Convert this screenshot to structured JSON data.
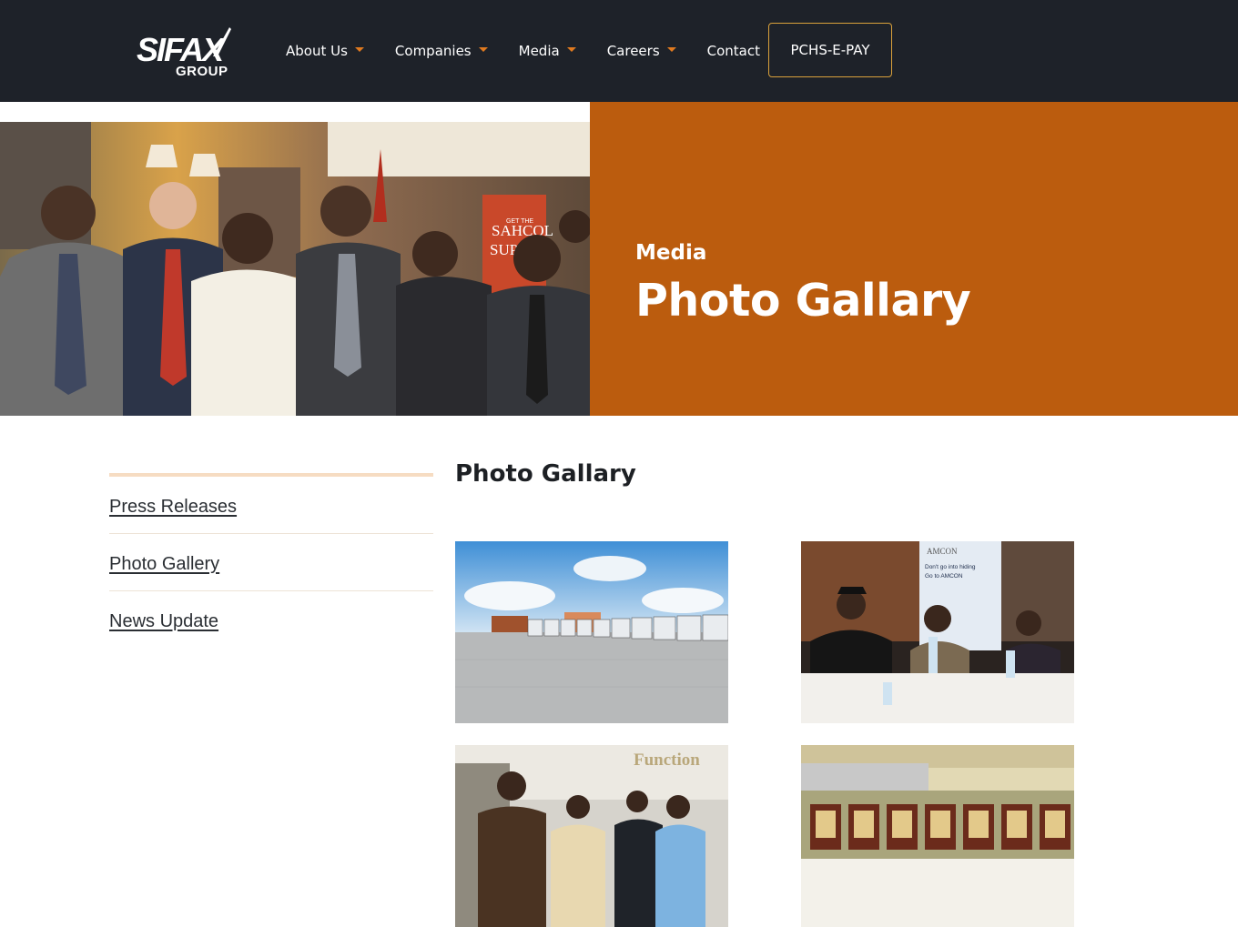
{
  "header": {
    "logo_word": "SIFAX",
    "logo_sub": "GROUP",
    "nav": [
      {
        "label": "About Us",
        "dropdown": true
      },
      {
        "label": "Companies",
        "dropdown": true
      },
      {
        "label": "Media",
        "dropdown": true
      },
      {
        "label": "Careers",
        "dropdown": true
      },
      {
        "label": "Contact",
        "dropdown": false
      }
    ],
    "pay_button": "PCHS-E-PAY"
  },
  "hero": {
    "kicker": "Media",
    "title": "Photo Gallary",
    "banner_text_1": "GET THE",
    "banner_text_2": "SAHCOL",
    "banner_text_3": "SUPP"
  },
  "sidebar": {
    "items": [
      {
        "label": "Press Releases"
      },
      {
        "label": "Photo Gallery"
      },
      {
        "label": "News Update"
      }
    ]
  },
  "main": {
    "title": "Photo Gallary",
    "photos": [
      {
        "subject": "trucks-yard"
      },
      {
        "subject": "amcon-dinner",
        "sign_text_1": "AMCON",
        "sign_text_2": "Don't go into hiding",
        "sign_text_3": "Go to AMCON"
      },
      {
        "subject": "function-guests",
        "wall_text": "Function"
      },
      {
        "subject": "award-plaques"
      }
    ]
  },
  "colors": {
    "topbar": "#1e2229",
    "accent": "#e07a1f",
    "hero_panel": "#bb5c0e",
    "pay_border": "#d9a13b"
  }
}
